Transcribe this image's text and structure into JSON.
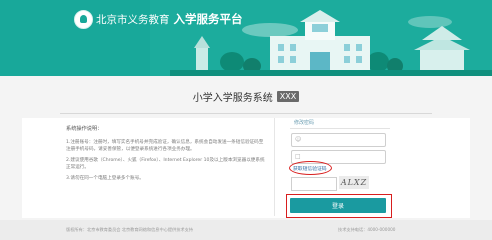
{
  "header": {
    "site_name": "北京市义务教育",
    "platform": "入学服务平台"
  },
  "main": {
    "title": "小学入学服务系统",
    "tag": "XXX"
  },
  "info": {
    "heading": "系统操作说明：",
    "p1": "1.注册账号：注册时，填写实名手机号并完成验证，确认信息，系统会自动发送一条短信验证码至注册手机号码，请妥善保管，以便登录系统进行各项业务办理。",
    "p2": "2.建议使用谷歌（Chrome）、火狐（Firefox）、Internet Explorer 10及以上版本浏览器以便系统正常运行。",
    "p3": "3.请勿在同一个电脑上登录多个账号。"
  },
  "login": {
    "title": "修改密码",
    "username_placeholder": "",
    "password_placeholder": "",
    "forgot": "获取短信验证码",
    "captcha_text": "ALXZ",
    "submit": "登录"
  },
  "footer": {
    "left": "版权所有：北京市教育委员会 北京教育网络和信息中心提供技术支持",
    "right": "技术支持电话：4000-000000"
  },
  "colors": {
    "banner": "#18a89a",
    "button": "#1a9aa0",
    "highlight": "#d81e1e"
  }
}
